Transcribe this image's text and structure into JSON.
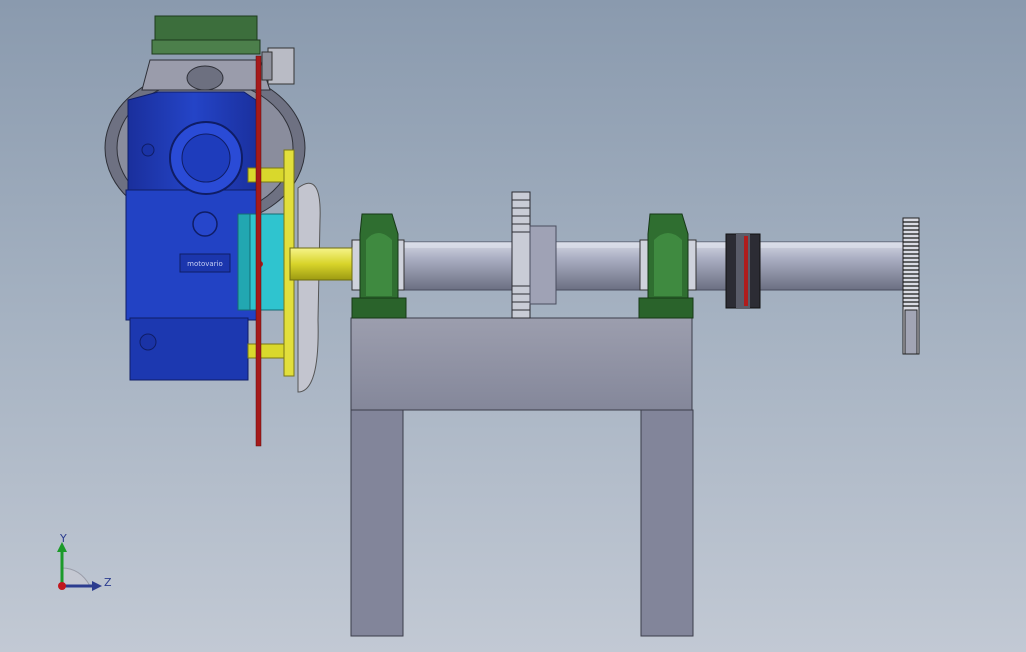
{
  "viewport": {
    "background_top": "#8a9aae",
    "background_bottom": "#c2c9d4"
  },
  "model": {
    "gearbox_label": "motovario",
    "colors": {
      "gearbox": "#1f3fbf",
      "motor_cap": "#3c6e3c",
      "bearing": "#2e6b2e",
      "shaft": "#a5a9bd",
      "input_shaft": "#e8e640",
      "flange": "#2fc4cf",
      "frame": "#8a8c9e",
      "chain": "#b01c1c"
    }
  },
  "triad": {
    "y_label": "Y",
    "z_label": "Z"
  }
}
